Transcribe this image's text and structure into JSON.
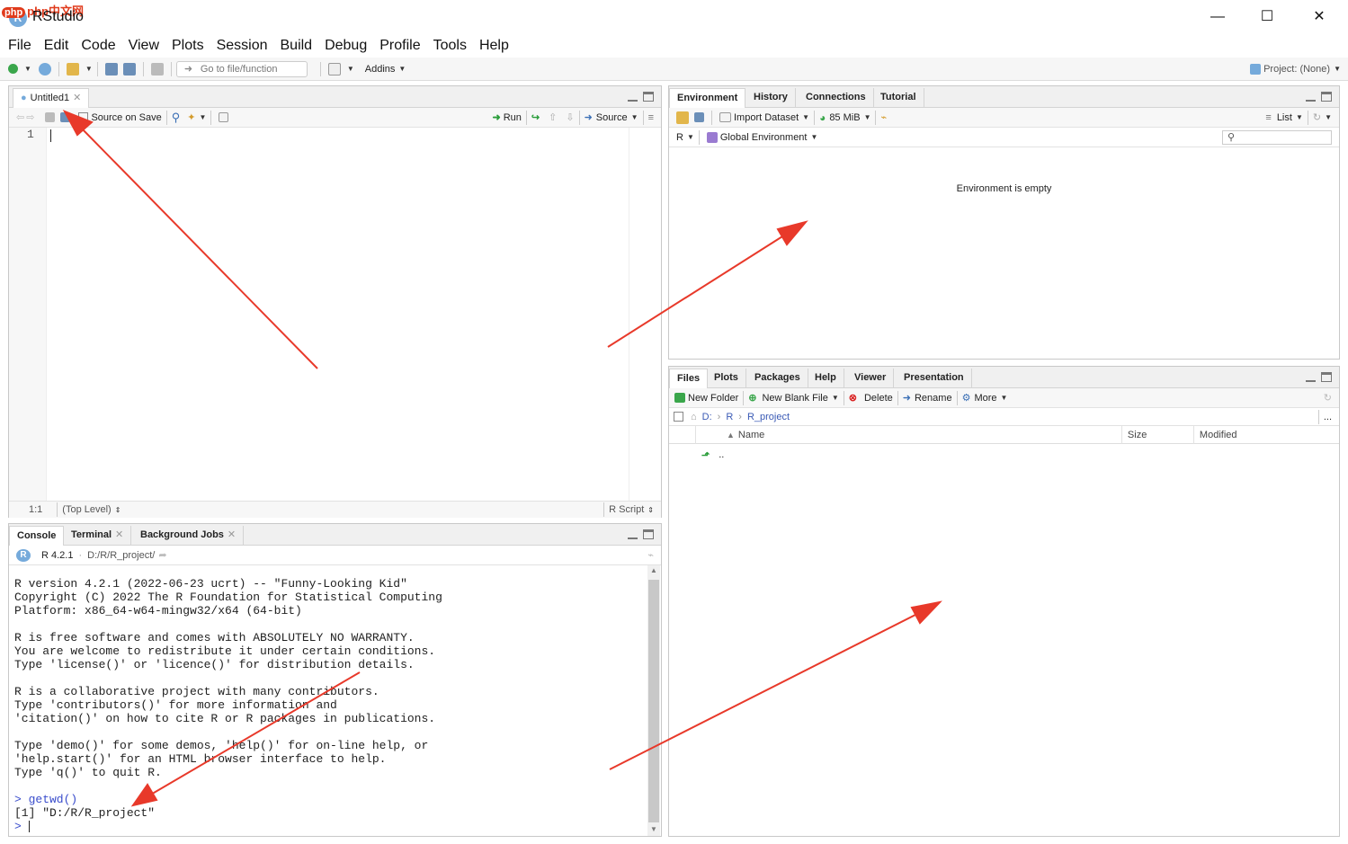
{
  "window": {
    "title": "RStudio",
    "watermark": "php中文网",
    "minimize": "—",
    "maximize": "☐",
    "close": "✕"
  },
  "menu": [
    "File",
    "Edit",
    "Code",
    "View",
    "Plots",
    "Session",
    "Build",
    "Debug",
    "Profile",
    "Tools",
    "Help"
  ],
  "toolbar": {
    "goto_placeholder": "Go to file/function",
    "addins": "Addins",
    "project": "Project: (None)"
  },
  "editor": {
    "tab": "Untitled1",
    "source_on_save": "Source on Save",
    "run": "Run",
    "source": "Source",
    "line_number": "1",
    "position": "1:1",
    "scope": "(Top Level)",
    "filetype": "R Script"
  },
  "console_pane": {
    "tabs": [
      "Console",
      "Terminal",
      "Background Jobs"
    ],
    "r_version": "R 4.2.1",
    "path": "D:/R/R_project/",
    "lines": [
      "R version 4.2.1 (2022-06-23 ucrt) -- \"Funny-Looking Kid\"",
      "Copyright (C) 2022 The R Foundation for Statistical Computing",
      "Platform: x86_64-w64-mingw32/x64 (64-bit)",
      "",
      "R is free software and comes with ABSOLUTELY NO WARRANTY.",
      "You are welcome to redistribute it under certain conditions.",
      "Type 'license()' or 'licence()' for distribution details.",
      "",
      "R is a collaborative project with many contributors.",
      "Type 'contributors()' for more information and",
      "'citation()' on how to cite R or R packages in publications.",
      "",
      "Type 'demo()' for some demos, 'help()' for on-line help, or",
      "'help.start()' for an HTML browser interface to help.",
      "Type 'q()' to quit R.",
      ""
    ],
    "cmd": "> getwd()",
    "result": "[1] \"D:/R/R_project\"",
    "prompt": ">"
  },
  "env_pane": {
    "tabs": [
      "Environment",
      "History",
      "Connections",
      "Tutorial"
    ],
    "import_dataset": "Import Dataset",
    "memory": "85 MiB",
    "list": "List",
    "lang": "R",
    "scope": "Global Environment",
    "empty_message": "Environment is empty"
  },
  "files_pane": {
    "tabs": [
      "Files",
      "Plots",
      "Packages",
      "Help",
      "Viewer",
      "Presentation"
    ],
    "new_folder": "New Folder",
    "new_blank_file": "New Blank File",
    "delete": "Delete",
    "rename": "Rename",
    "more": "More",
    "breadcrumb": [
      "D:",
      "R",
      "R_project"
    ],
    "columns": [
      "Name",
      "Size",
      "Modified"
    ],
    "rows": [
      ".."
    ],
    "ellipsis": "..."
  },
  "colors": {
    "arrow": "#e8392a",
    "accent": "#75aadb"
  }
}
